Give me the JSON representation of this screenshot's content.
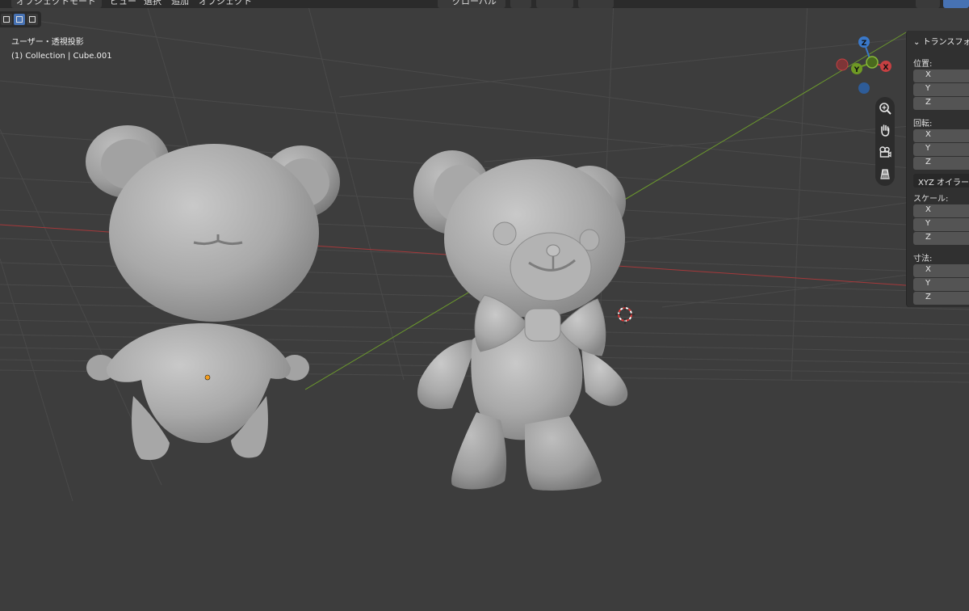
{
  "header": {
    "mode_label": "オブジェクトモード",
    "menu": [
      "ビュー",
      "選択",
      "追加",
      "オブジェクト"
    ],
    "transform_orientation": "グローバル"
  },
  "viewport": {
    "view_name": "ユーザー・透視投影",
    "object_info": "(1) Collection | Cube.001"
  },
  "gizmo": {
    "z": "Z",
    "y": "Y",
    "x": "X"
  },
  "colors": {
    "x_axis": "#c64042",
    "y_axis": "#6f9a24",
    "z_axis": "#3a78c9",
    "accent": "#4772b3"
  },
  "nav_icons": [
    "zoom-icon",
    "hand-pan-icon",
    "camera-icon",
    "grid-ortho-icon"
  ],
  "npanel": {
    "title": "トランスフォ",
    "location_label": "位置:",
    "rotation_label": "回転:",
    "rotation_mode": "XYZ オイラー",
    "scale_label": "スケール:",
    "dimensions_label": "寸法:",
    "axes": [
      "X",
      "Y",
      "Z"
    ]
  }
}
